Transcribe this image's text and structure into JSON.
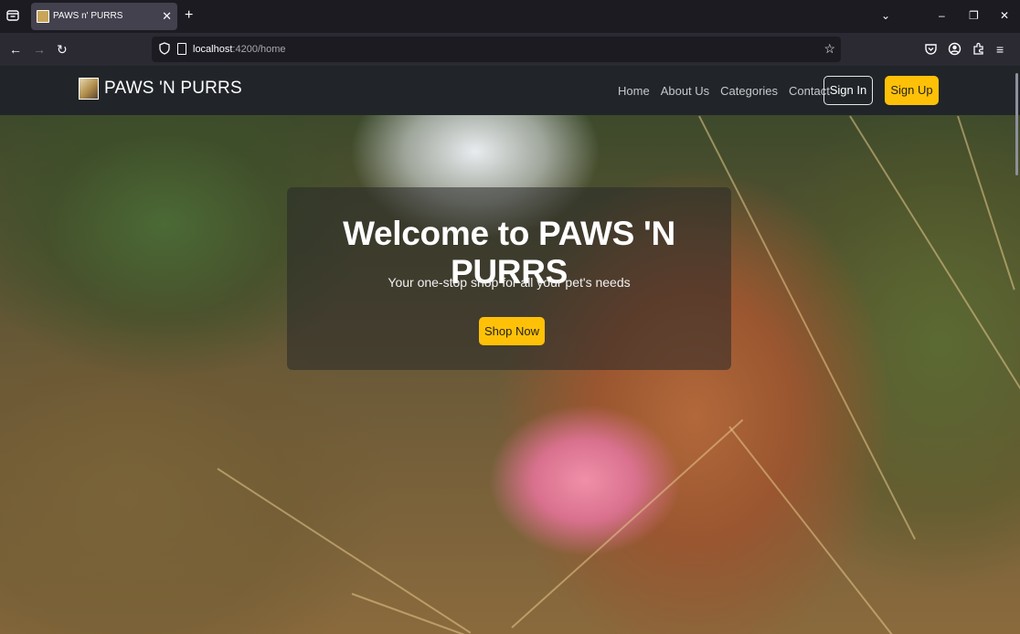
{
  "browser": {
    "tab_title": "PAWS n' PURRS",
    "tab_close": "✕",
    "new_tab": "+",
    "url_host": "localhost",
    "url_rest": ":4200/home",
    "controls": {
      "minimize": "–",
      "restore": "❐",
      "close": "✕",
      "overflow": "⌄"
    },
    "nav": {
      "back": "←",
      "forward": "→",
      "reload": "↻",
      "star": "☆",
      "menu": "≡"
    }
  },
  "site": {
    "brand": "PAWS 'N PURRS",
    "nav_links": [
      "Home",
      "About Us",
      "Categories",
      "Contact"
    ],
    "signin_label": "Sign In",
    "signup_label": "Sign Up"
  },
  "hero": {
    "title": "Welcome to PAWS 'N PURRS",
    "subtitle": "Your one-stop shop for all your pet's needs",
    "cta_label": "Shop Now"
  },
  "colors": {
    "accent": "#ffc107",
    "nav_bg": "#212529",
    "browser_bg": "#1c1b22",
    "toolbar_bg": "#2b2a33"
  },
  "icons": [
    "tab-list-icon",
    "favicon-icon",
    "close-tab-icon",
    "new-tab-icon",
    "chevron-down-icon",
    "minimize-icon",
    "restore-icon",
    "close-window-icon",
    "back-icon",
    "forward-icon",
    "reload-icon",
    "shield-icon",
    "page-icon",
    "bookmark-star-icon",
    "pocket-icon",
    "account-icon",
    "extensions-icon",
    "menu-icon"
  ]
}
